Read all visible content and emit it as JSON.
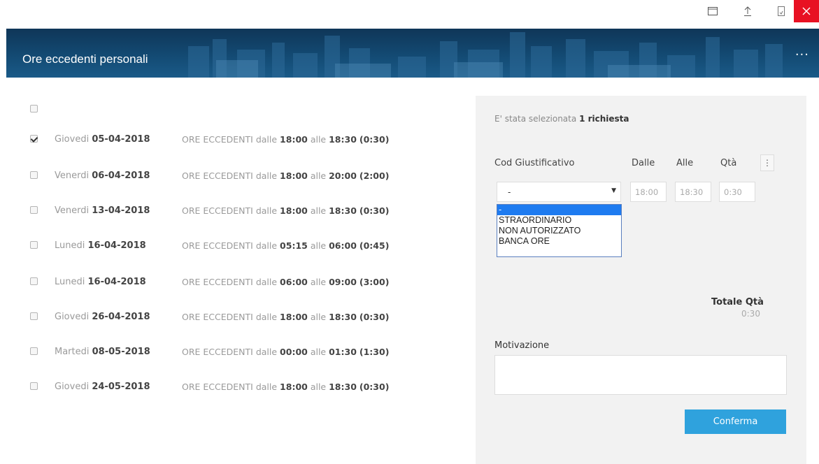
{
  "window": {
    "controls": [
      "restore-icon",
      "upload-icon",
      "pin-icon",
      "close-icon"
    ],
    "close_color": "#e81123"
  },
  "header": {
    "title": "Ore eccedenti personali",
    "menu": "...",
    "bg_color": "#134a73"
  },
  "list": {
    "select_all_checked": false,
    "rows": [
      {
        "day": "Giovedi",
        "date": "05-04-2018",
        "prefix": "ORE ECCEDENTI dalle",
        "from": "18:00",
        "mid": "alle",
        "to": "18:30",
        "dur": "(0:30)",
        "checked": true
      },
      {
        "day": "Venerdi",
        "date": "06-04-2018",
        "prefix": "ORE ECCEDENTI dalle",
        "from": "18:00",
        "mid": "alle",
        "to": "20:00",
        "dur": "(2:00)",
        "checked": false
      },
      {
        "day": "Venerdi",
        "date": "13-04-2018",
        "prefix": "ORE ECCEDENTI dalle",
        "from": "18:00",
        "mid": "alle",
        "to": "18:30",
        "dur": "(0:30)",
        "checked": false
      },
      {
        "day": "Lunedi",
        "date": "16-04-2018",
        "prefix": "ORE ECCEDENTI dalle",
        "from": "05:15",
        "mid": "alle",
        "to": "06:00",
        "dur": "(0:45)",
        "checked": false
      },
      {
        "day": "Lunedi",
        "date": "16-04-2018",
        "prefix": "ORE ECCEDENTI dalle",
        "from": "06:00",
        "mid": "alle",
        "to": "09:00",
        "dur": "(3:00)",
        "checked": false
      },
      {
        "day": "Giovedi",
        "date": "26-04-2018",
        "prefix": "ORE ECCEDENTI dalle",
        "from": "18:00",
        "mid": "alle",
        "to": "18:30",
        "dur": "(0:30)",
        "checked": false
      },
      {
        "day": "Martedi",
        "date": "08-05-2018",
        "prefix": "ORE ECCEDENTI dalle",
        "from": "00:00",
        "mid": "alle",
        "to": "01:30",
        "dur": "(1:30)",
        "checked": false
      },
      {
        "day": "Giovedi",
        "date": "24-05-2018",
        "prefix": "ORE ECCEDENTI dalle",
        "from": "18:00",
        "mid": "alle",
        "to": "18:30",
        "dur": "(0:30)",
        "checked": false
      }
    ]
  },
  "panel": {
    "selection_prefix": "E' stata selezionata",
    "selection_count": "1 richiesta",
    "columns": {
      "code": "Cod Giustificativo",
      "from": "Dalle",
      "to": "Alle",
      "qty": "Qtà"
    },
    "more": "⋮",
    "select_value": "-",
    "select_options": [
      "-",
      "STRAORDINARIO",
      "NON AUTORIZZATO",
      "BANCA ORE"
    ],
    "from_value": "18:00",
    "to_value": "18:30",
    "qty_value": "0:30",
    "total_label": "Totale Qtà",
    "total_value": "0:30",
    "reason_label": "Motivazione",
    "reason_value": "",
    "confirm_label": "Conferma",
    "confirm_color": "#2fa2dd"
  }
}
